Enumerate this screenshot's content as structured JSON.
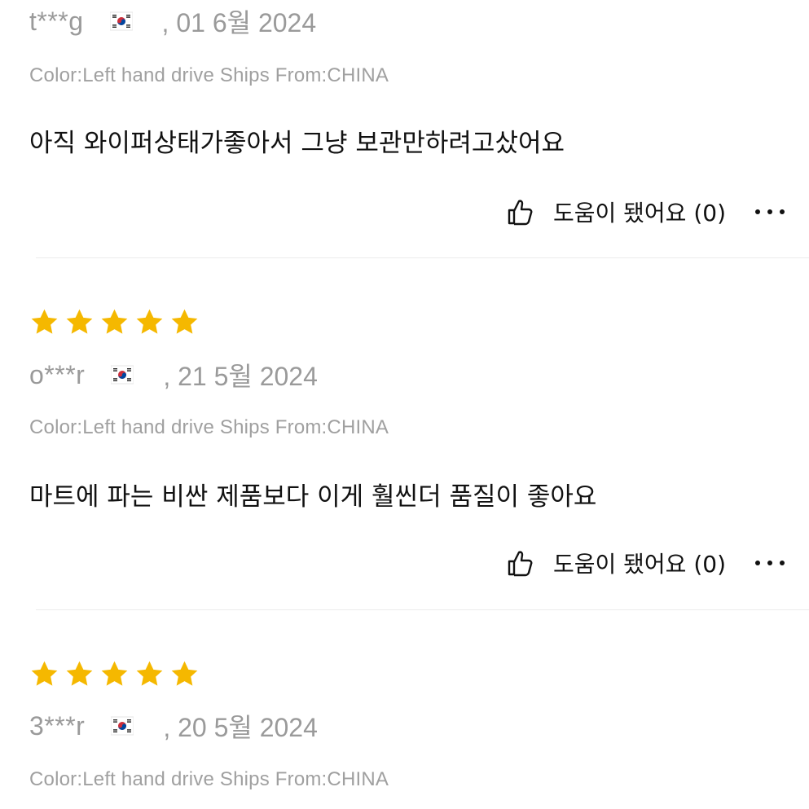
{
  "reviews": [
    {
      "reviewer": "t***g",
      "date": ", 01 6월 2024",
      "sku": "Color:Left hand drive Ships From:CHINA",
      "text": "아직 와이퍼상태가좋아서 그냥 보관만하려고샀어요",
      "helpful_label": "도움이 됐어요 (0)"
    },
    {
      "rating": 5,
      "reviewer": "o***r",
      "date": ", 21 5월 2024",
      "sku": "Color:Left hand drive Ships From:CHINA",
      "text": "마트에 파는 비싼 제품보다 이게 훨씬더 품질이 좋아요",
      "helpful_label": "도움이 됐어요 (0)"
    },
    {
      "rating": 5,
      "reviewer": "3***r",
      "date": ", 20 5월 2024",
      "sku": "Color:Left hand drive Ships From:CHINA"
    }
  ],
  "icons": {
    "star": "star-icon",
    "flag": "south-korea-flag-icon",
    "thumb": "thumbs-up-icon",
    "more": "more-options-icon"
  },
  "colors": {
    "star": "#F5B800",
    "muted_text": "#9A9A9A",
    "divider": "#ECECEC"
  }
}
